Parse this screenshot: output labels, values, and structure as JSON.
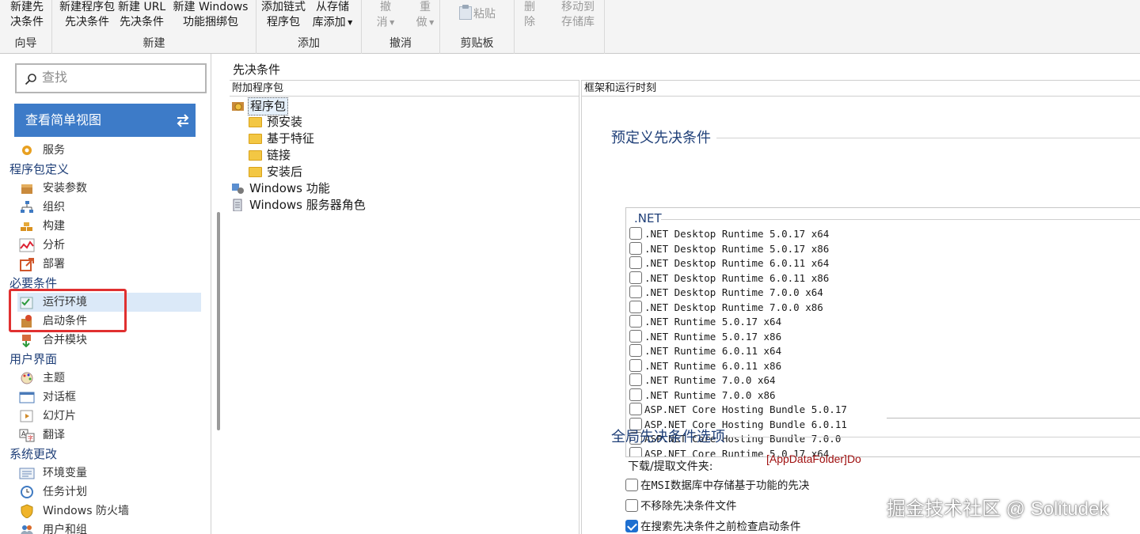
{
  "ribbon": {
    "groups": [
      {
        "label": "向导",
        "buttons": [
          {
            "line1": "新建先",
            "line2": "决条件",
            "disabled": false
          }
        ]
      },
      {
        "label": "新建",
        "buttons": [
          {
            "line1": "新建程序包",
            "line2": "先决条件",
            "disabled": false
          },
          {
            "line1": "新建 URL",
            "line2": "先决条件",
            "disabled": false
          },
          {
            "line1": "新建 Windows",
            "line2": "功能捆绑包",
            "disabled": false
          }
        ]
      },
      {
        "label": "添加",
        "buttons": [
          {
            "line1": "添加链式",
            "line2": "程序包",
            "disabled": false
          },
          {
            "line1": "从存储",
            "line2": "库添加",
            "disabled": false
          }
        ]
      },
      {
        "label": "撤消",
        "buttons": [
          {
            "line1": "撤",
            "line2": "消",
            "disabled": true
          },
          {
            "line1": "重",
            "line2": "做",
            "disabled": true
          }
        ]
      },
      {
        "label": "剪贴板",
        "buttons": [
          {
            "line1": "粘贴",
            "line2": "",
            "disabled": true
          }
        ]
      },
      {
        "label": "",
        "buttons": [
          {
            "line1": "删",
            "line2": "除",
            "disabled": true
          },
          {
            "line1": "移动到",
            "line2": "存储库",
            "disabled": true
          }
        ]
      }
    ]
  },
  "sidebar": {
    "search_placeholder": "查找",
    "simple_view_label": "查看简单视图",
    "sections": [
      {
        "title": "",
        "items": [
          {
            "label": "服务",
            "icon": "gear-icon",
            "selected": false
          }
        ]
      },
      {
        "title": "程序包定义",
        "items": [
          {
            "label": "安装参数",
            "icon": "package-icon",
            "selected": false
          },
          {
            "label": "组织",
            "icon": "hierarchy-icon",
            "selected": false
          },
          {
            "label": "构建",
            "icon": "bricks-icon",
            "selected": false
          },
          {
            "label": "分析",
            "icon": "analysis-icon",
            "selected": false
          },
          {
            "label": "部署",
            "icon": "deploy-icon",
            "selected": false
          }
        ]
      },
      {
        "title": "必要条件",
        "items": [
          {
            "label": "运行环境",
            "icon": "runtime-icon",
            "selected": true
          },
          {
            "label": "启动条件",
            "icon": "launch-condition-icon",
            "selected": false
          },
          {
            "label": "合并模块",
            "icon": "merge-module-icon",
            "selected": false
          }
        ]
      },
      {
        "title": "用户界面",
        "items": [
          {
            "label": "主题",
            "icon": "palette-icon",
            "selected": false
          },
          {
            "label": "对话框",
            "icon": "dialog-icon",
            "selected": false
          },
          {
            "label": "幻灯片",
            "icon": "slideshow-icon",
            "selected": false
          },
          {
            "label": "翻译",
            "icon": "translate-icon",
            "selected": false
          }
        ]
      },
      {
        "title": "系统更改",
        "items": [
          {
            "label": "环境变量",
            "icon": "env-var-icon",
            "selected": false
          },
          {
            "label": "任务计划",
            "icon": "clock-icon",
            "selected": false
          },
          {
            "label": "Windows 防火墙",
            "icon": "shield-icon",
            "selected": false
          },
          {
            "label": "用户和组",
            "icon": "users-icon",
            "selected": false
          }
        ]
      }
    ]
  },
  "main": {
    "title": "先决条件",
    "left_panel": {
      "header": "附加程序包",
      "tree": [
        {
          "label": "程序包",
          "icon": "package-root-icon",
          "level": 0,
          "selected": true
        },
        {
          "label": "预安装",
          "icon": "folder-icon",
          "level": 1,
          "selected": false
        },
        {
          "label": "基于特征",
          "icon": "folder-icon",
          "level": 1,
          "selected": false
        },
        {
          "label": "链接",
          "icon": "folder-icon",
          "level": 1,
          "selected": false
        },
        {
          "label": "安装后",
          "icon": "folder-icon",
          "level": 1,
          "selected": false
        },
        {
          "label": "Windows 功能",
          "icon": "windows-feature-icon",
          "level": 0,
          "selected": false
        },
        {
          "label": "Windows 服务器角色",
          "icon": "server-role-icon",
          "level": 0,
          "selected": false
        }
      ]
    },
    "right_panel": {
      "header": "框架和运行时刻",
      "predefined_title": "预定义先决条件",
      "group_label": ".NET",
      "prerequisites": [
        {
          "label": ".NET Desktop Runtime 5.0.17 x64",
          "checked": false
        },
        {
          "label": ".NET Desktop Runtime 5.0.17 x86",
          "checked": false
        },
        {
          "label": ".NET Desktop Runtime 6.0.11 x64",
          "checked": false
        },
        {
          "label": ".NET Desktop Runtime 6.0.11 x86",
          "checked": false
        },
        {
          "label": ".NET Desktop Runtime 7.0.0 x64",
          "checked": false
        },
        {
          "label": ".NET Desktop Runtime 7.0.0 x86",
          "checked": false
        },
        {
          "label": ".NET Runtime 5.0.17 x64",
          "checked": false
        },
        {
          "label": ".NET Runtime 5.0.17 x86",
          "checked": false
        },
        {
          "label": ".NET Runtime 6.0.11 x64",
          "checked": false
        },
        {
          "label": ".NET Runtime 6.0.11 x86",
          "checked": false
        },
        {
          "label": ".NET Runtime 7.0.0 x64",
          "checked": false
        },
        {
          "label": ".NET Runtime 7.0.0 x86",
          "checked": false
        },
        {
          "label": "ASP.NET Core Hosting Bundle 5.0.17",
          "checked": false
        },
        {
          "label": "ASP.NET Core Hosting Bundle 6.0.11",
          "checked": false
        },
        {
          "label": "ASP.NET Core Hosting Bundle 7.0.0",
          "checked": false
        },
        {
          "label": "ASP.NET Core Runtime 5.0.17 x64",
          "checked": false
        }
      ],
      "global_title": "全局先决条件选项",
      "download_label": "下载/提取文件夹:",
      "download_value": "[AppDataFolder]Do",
      "options": [
        {
          "label": "在MSI数据库中存储基于功能的先决",
          "checked": false
        },
        {
          "label": "不移除先决条件文件",
          "checked": false
        },
        {
          "label": "在搜索先决条件之前检查启动条件",
          "checked": true
        }
      ]
    }
  },
  "watermark": "掘金技术社区 @ Solitudek",
  "colors": {
    "accent": "#3d7bc8",
    "highlight_box": "#e03030",
    "section_title": "#1f3f78",
    "selected_row": "#dbe9f8"
  }
}
